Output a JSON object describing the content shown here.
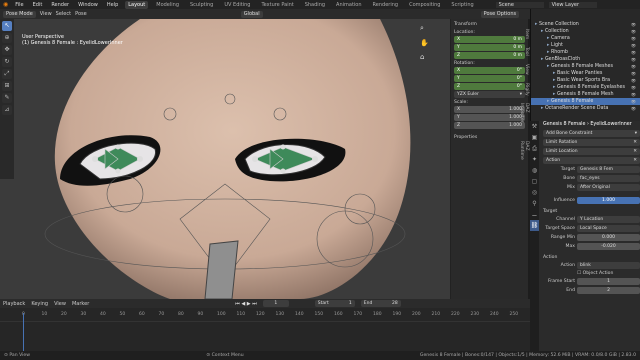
{
  "menu": {
    "items": [
      "File",
      "Edit",
      "Render",
      "Window",
      "Help"
    ],
    "workspaces": [
      "Layout",
      "Modeling",
      "Sculpting",
      "UV Editing",
      "Texture Paint",
      "Shading",
      "Animation",
      "Rendering",
      "Compositing",
      "Scripting"
    ],
    "scene": "Scene",
    "view_layer": "View Layer"
  },
  "header": {
    "mode": "Pose Mode",
    "view": "View",
    "select": "Select",
    "pose": "Pose",
    "orientation": "Global",
    "pose_options": "Pose Options"
  },
  "viewport": {
    "line1": "User Perspective",
    "line2": "(1) Genesis 8 Female : EyelidLowerInner"
  },
  "npanel": {
    "section": "Transform",
    "location": "Location:",
    "loc": [
      {
        "axis": "X",
        "val": "0 m"
      },
      {
        "axis": "Y",
        "val": "0 m"
      },
      {
        "axis": "Z",
        "val": "0 m"
      }
    ],
    "rotation": "Rotation:",
    "rot": [
      {
        "axis": "X",
        "val": "0°"
      },
      {
        "axis": "Y",
        "val": "0°"
      },
      {
        "axis": "Z",
        "val": "0°"
      }
    ],
    "rot_mode": "YZX Euler",
    "scale": "Scale:",
    "scl": [
      {
        "axis": "X",
        "val": "1.000"
      },
      {
        "axis": "Y",
        "val": "1.000"
      },
      {
        "axis": "Z",
        "val": "1.000"
      }
    ],
    "properties": "Properties",
    "tabs": [
      "Item",
      "Tool",
      "View",
      "Rigify",
      "DAZ Importer",
      "DAZ Runtime"
    ]
  },
  "outliner": {
    "rows": [
      {
        "t": "Scene Collection",
        "d": 0
      },
      {
        "t": "Collection",
        "d": 1
      },
      {
        "t": "Camera",
        "d": 2
      },
      {
        "t": "Light",
        "d": 2
      },
      {
        "t": "Rhomb",
        "d": 2
      },
      {
        "t": "GenBloasCloth",
        "d": 1
      },
      {
        "t": "Genesis 8 Female Meshes",
        "d": 2
      },
      {
        "t": "Basic Wear Panties",
        "d": 3
      },
      {
        "t": "Basic Wear Sports Bra",
        "d": 3
      },
      {
        "t": "Genesis 8 Female Eyelashes",
        "d": 3
      },
      {
        "t": "Genesis 8 Female Mesh",
        "d": 3
      },
      {
        "t": "Genesis 8 Female",
        "d": 2,
        "sel": true
      },
      {
        "t": "OctaneRender Scene Data",
        "d": 1
      }
    ]
  },
  "props": {
    "header": "Genesis 8 Female",
    "bone": "EyelidLowerInner",
    "add": "Add Bone Constraint",
    "c1": "Limit Rotation",
    "c2": "Limit Location",
    "c3": "Action",
    "target_lbl": "Target",
    "target": "Genesis 8 Fem",
    "bone_lbl": "Bone",
    "bone_val": "fac_eyes",
    "mix_lbl": "Mix",
    "mix": "After Original",
    "inf_lbl": "Influence",
    "inf": "1.000",
    "target_sec": "Target",
    "channel_lbl": "Channel",
    "channel": "Y Location",
    "space_lbl": "Target Space",
    "space": "Local Space",
    "rmin_lbl": "Range Min",
    "rmin": "0.000",
    "max_lbl": "Max",
    "max": "-0.020",
    "action_sec": "Action",
    "action_lbl": "Action",
    "action": "blink",
    "obj_action": "Object Action",
    "fstart_lbl": "Frame Start",
    "fstart": "1",
    "end_lbl": "End",
    "end": "2"
  },
  "timeline": {
    "playback": "Playback",
    "keying": "Keying",
    "view": "View",
    "marker": "Marker",
    "frame": "1",
    "start_lbl": "Start",
    "start": "1",
    "end_lbl": "End",
    "end": "28",
    "ticks": [
      "0",
      "10",
      "20",
      "30",
      "40",
      "50",
      "60",
      "70",
      "80",
      "90",
      "100",
      "110",
      "120",
      "130",
      "140",
      "150",
      "160",
      "170",
      "180",
      "190",
      "200",
      "210",
      "220",
      "230",
      "240",
      "250"
    ]
  },
  "status": {
    "left": "Pan View",
    "mid": "Context Menu",
    "right": "Genesis 8 Female | Bones:0/147 | Objects:1/5 | Memory: 52.6 MiB | VRAM: 0.0/8.0 GiB | 2.83.0"
  },
  "colors": {
    "accent": "#4772b3",
    "green_field": "#4f7a3d",
    "bone": "#3e8a5a"
  }
}
